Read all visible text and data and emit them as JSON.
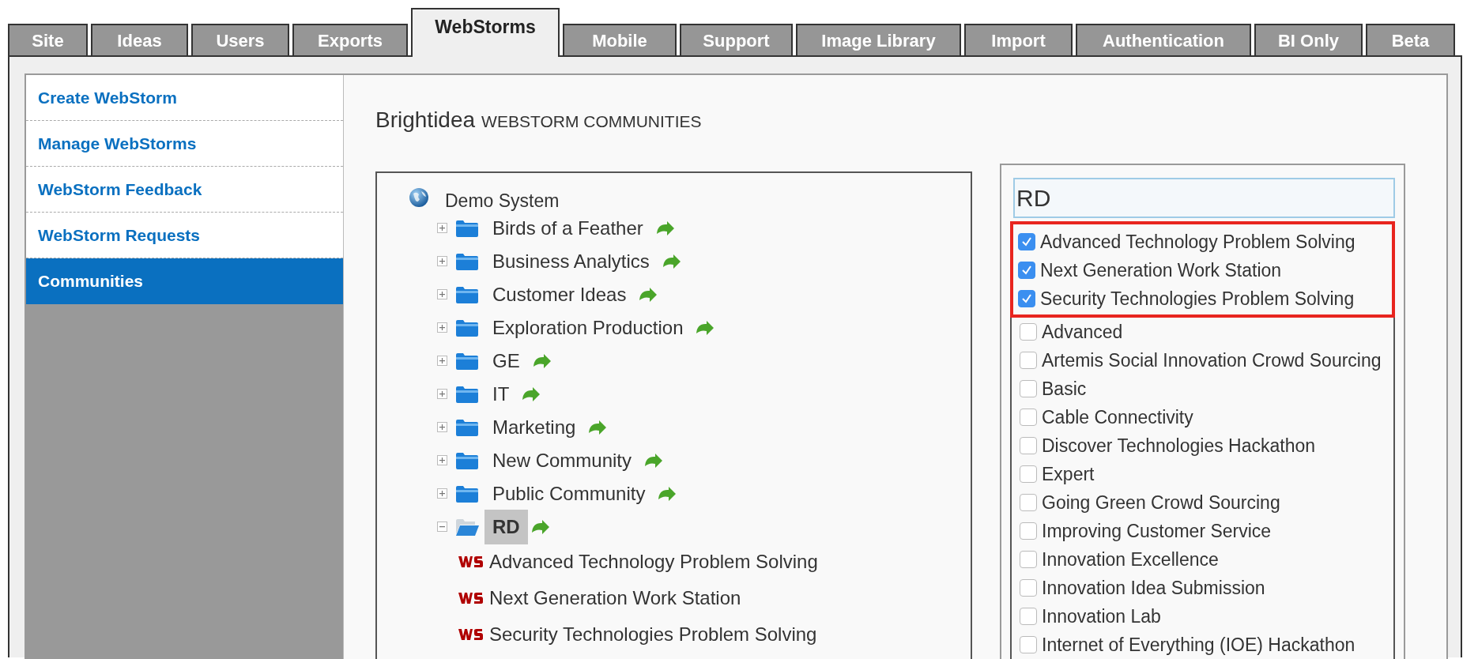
{
  "tabs": [
    {
      "label": "Site",
      "selected": false
    },
    {
      "label": "Ideas",
      "selected": false
    },
    {
      "label": "Users",
      "selected": false
    },
    {
      "label": "Exports",
      "selected": false
    },
    {
      "label": "WebStorms",
      "selected": true
    },
    {
      "label": "Mobile",
      "selected": false
    },
    {
      "label": "Support",
      "selected": false
    },
    {
      "label": "Image Library",
      "selected": false
    },
    {
      "label": "Import",
      "selected": false
    },
    {
      "label": "Authentication",
      "selected": false
    },
    {
      "label": "BI Only",
      "selected": false
    },
    {
      "label": "Beta",
      "selected": false
    }
  ],
  "sidebar": {
    "items": [
      {
        "label": "Create WebStorm",
        "selected": false
      },
      {
        "label": "Manage WebStorms",
        "selected": false
      },
      {
        "label": "WebStorm Feedback",
        "selected": false
      },
      {
        "label": "WebStorm Requests",
        "selected": false
      },
      {
        "label": "Communities",
        "selected": true
      }
    ]
  },
  "heading": {
    "brand": "Brightidea",
    "subtitle": "WEBSTORM COMMUNITIES"
  },
  "tree": {
    "root": {
      "label": "Demo System",
      "children": [
        {
          "kind": "folder",
          "label": "Birds of a Feather",
          "expanded": false,
          "selected": false
        },
        {
          "kind": "folder",
          "label": "Business Analytics",
          "expanded": false,
          "selected": false
        },
        {
          "kind": "folder",
          "label": "Customer Ideas",
          "expanded": false,
          "selected": false
        },
        {
          "kind": "folder",
          "label": "Exploration Production",
          "expanded": false,
          "selected": false
        },
        {
          "kind": "folder",
          "label": "GE",
          "expanded": false,
          "selected": false
        },
        {
          "kind": "folder",
          "label": "IT",
          "expanded": false,
          "selected": false
        },
        {
          "kind": "folder",
          "label": "Marketing",
          "expanded": false,
          "selected": false
        },
        {
          "kind": "folder",
          "label": "New Community",
          "expanded": false,
          "selected": false
        },
        {
          "kind": "folder",
          "label": "Public Community",
          "expanded": false,
          "selected": false
        },
        {
          "kind": "folder",
          "label": "RD",
          "expanded": true,
          "selected": true,
          "children": [
            {
              "kind": "webstorm",
              "label": "Advanced Technology Problem Solving"
            },
            {
              "kind": "webstorm",
              "label": "Next Generation Work Station"
            },
            {
              "kind": "webstorm",
              "label": "Security Technologies Problem Solving"
            }
          ]
        }
      ]
    }
  },
  "filter": {
    "value": "RD"
  },
  "webstorms": [
    {
      "label": "Advanced Technology Problem Solving",
      "checked": true,
      "highlighted": true
    },
    {
      "label": "Next Generation Work Station",
      "checked": true,
      "highlighted": true
    },
    {
      "label": "Security Technologies Problem Solving",
      "checked": true,
      "highlighted": true
    },
    {
      "label": "Advanced",
      "checked": false,
      "highlighted": false
    },
    {
      "label": "Artemis Social Innovation Crowd Sourcing",
      "checked": false,
      "highlighted": false
    },
    {
      "label": "Basic",
      "checked": false,
      "highlighted": false
    },
    {
      "label": "Cable Connectivity",
      "checked": false,
      "highlighted": false
    },
    {
      "label": "Discover Technologies Hackathon",
      "checked": false,
      "highlighted": false
    },
    {
      "label": "Expert",
      "checked": false,
      "highlighted": false
    },
    {
      "label": "Going Green Crowd Sourcing",
      "checked": false,
      "highlighted": false
    },
    {
      "label": "Improving Customer Service",
      "checked": false,
      "highlighted": false
    },
    {
      "label": "Innovation Excellence",
      "checked": false,
      "highlighted": false
    },
    {
      "label": "Innovation Idea Submission",
      "checked": false,
      "highlighted": false
    },
    {
      "label": "Innovation Lab",
      "checked": false,
      "highlighted": false
    },
    {
      "label": "Internet of Everything (IOE) Hackathon",
      "checked": false,
      "highlighted": false
    }
  ]
}
